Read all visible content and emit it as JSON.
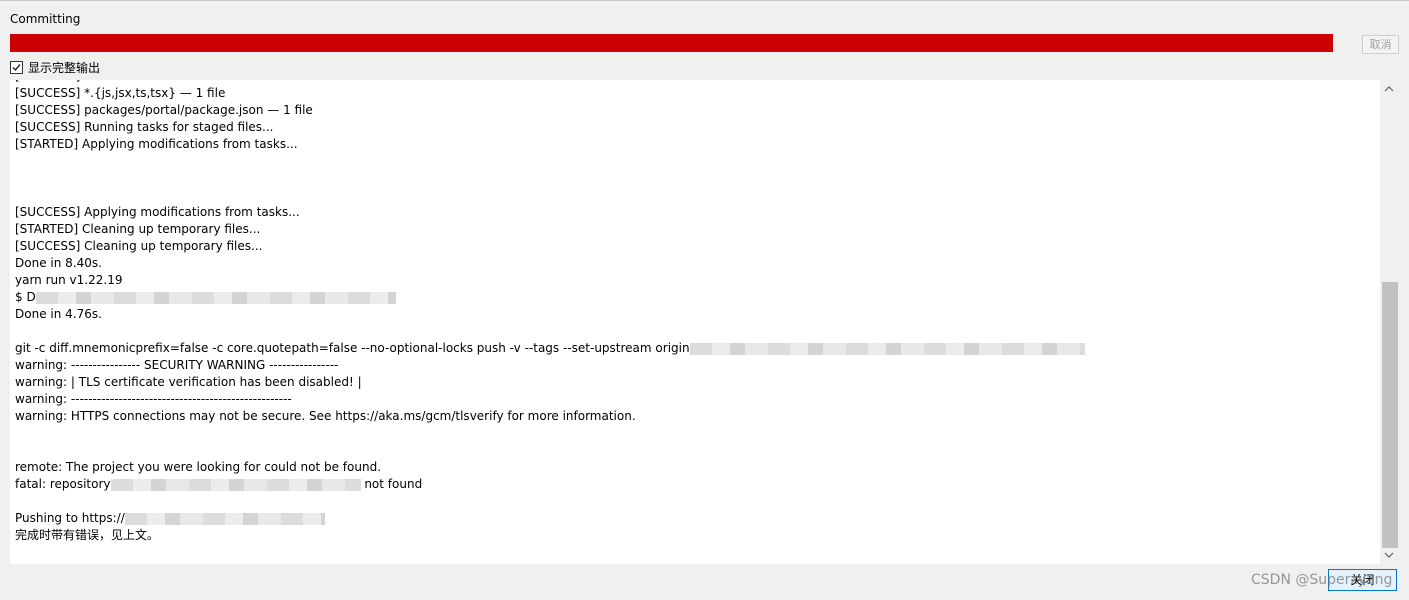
{
  "window": {
    "title": "Committing"
  },
  "progress": {
    "fraction": 1.0,
    "color": "#cc0000"
  },
  "buttons": {
    "cancel_label": "取消",
    "close_label": "关闭"
  },
  "checkbox": {
    "label": "显示完整输出",
    "checked": true
  },
  "output": {
    "lines": [
      {
        "text": "[SUCCESS] eslint --fix"
      },
      {
        "text": "[SUCCESS] *.{js,jsx,ts,tsx} — 1 file"
      },
      {
        "text": "[SUCCESS] packages/portal/package.json — 1 file"
      },
      {
        "text": "[SUCCESS] Running tasks for staged files..."
      },
      {
        "text": "[STARTED] Applying modifications from tasks..."
      },
      {
        "text": ""
      },
      {
        "text": ""
      },
      {
        "text": ""
      },
      {
        "text": "[SUCCESS] Applying modifications from tasks..."
      },
      {
        "text": "[STARTED] Cleaning up temporary files..."
      },
      {
        "text": "[SUCCESS] Cleaning up temporary files..."
      },
      {
        "text": "Done in 8.40s."
      },
      {
        "text": "yarn run v1.22.19"
      },
      {
        "text": "$ D",
        "redacted_after": true
      },
      {
        "text": "Done in 4.76s."
      },
      {
        "text": ""
      },
      {
        "text": "git -c diff.mnemonicprefix=false -c core.quotepath=false --no-optional-locks push -v --tags --set-upstream origin",
        "redacted_after": true
      },
      {
        "text": "warning: ---------------- SECURITY WARNING ----------------"
      },
      {
        "text": "warning: | TLS certificate verification has been disabled! |"
      },
      {
        "text": "warning: ---------------------------------------------------"
      },
      {
        "text": "warning: HTTPS connections may not be secure. See https://aka.ms/gcm/tlsverify for more information."
      },
      {
        "text": ""
      },
      {
        "text": ""
      },
      {
        "text": "remote: The project you were looking for could not be found."
      },
      {
        "text": "fatal: repository",
        "redacted_after": true,
        "suffix": "not found"
      },
      {
        "text": ""
      },
      {
        "text": "Pushing to https://",
        "redacted_after": true
      },
      {
        "text": "完成时带有错误，见上文。"
      }
    ]
  },
  "watermark": {
    "text": "CSDN @Superzyang"
  },
  "scrollbar": {
    "position_fraction": 0.58
  }
}
